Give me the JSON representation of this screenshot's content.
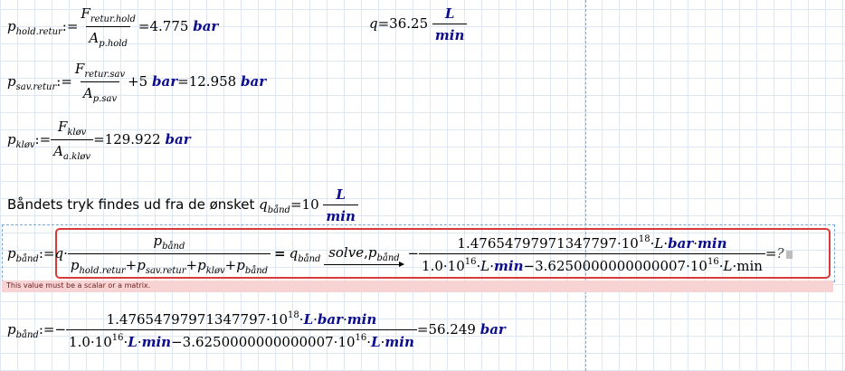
{
  "eq_hold": {
    "lhs": "p",
    "lhs_sub": "hold.retur",
    "assign": ":=",
    "num": "F",
    "num_sub": "retur.hold",
    "den": "A",
    "den_sub": "p.hold",
    "result": "=4.775",
    "unit": "bar"
  },
  "eq_q": {
    "lhs": "q",
    "result": "=36.25",
    "unit_num": "L",
    "unit_den": "min"
  },
  "eq_sav": {
    "lhs": "p",
    "lhs_sub": "sav.retur",
    "assign": ":=",
    "num": "F",
    "num_sub": "retur.sav",
    "den": "A",
    "den_sub": "p.sav",
    "plus": "+5",
    "unit1": "bar",
    "result": "=12.958",
    "unit2": "bar"
  },
  "eq_klov": {
    "lhs": "p",
    "lhs_sub": "kløv",
    "assign": ":=",
    "num": "F",
    "num_sub": "kløv",
    "den": "A",
    "den_sub": "a.kløv",
    "result": "=129.922",
    "unit": "bar"
  },
  "text_band": {
    "label": "Båndets tryk findes ud fra de ønsket",
    "var": "q",
    "var_sub": "bånd",
    "result": "=10",
    "unit_num": "L",
    "unit_den": "min"
  },
  "solve_eq": {
    "lhs": "p",
    "lhs_sub": "bånd",
    "assign": ":=",
    "q": "q",
    "dot": "·",
    "frac_num": "p",
    "frac_num_sub": "bånd",
    "den_t1": "p",
    "den_t1_sub": "hold.retur",
    "den_t2": "p",
    "den_t2_sub": "sav.retur",
    "den_t3": "p",
    "den_t3_sub": "kløv",
    "den_t4": "p",
    "den_t4_sub": "bånd",
    "plus": "+",
    "equals": "=",
    "rhs_q": "q",
    "rhs_q_sub": "bånd",
    "keyword": "solve",
    "keyword_sep": ",",
    "keyword_var": "p",
    "keyword_var_sub": "bånd",
    "minus": "−",
    "res_num_mant": "1.47654797971347797",
    "res_num_base": "10",
    "res_num_exp": "18",
    "res_num_L": "L",
    "res_num_bar": "bar",
    "res_num_min": "min",
    "res_den_a": "1.0",
    "res_den_base": "10",
    "res_den_exp": "16",
    "res_den_L": "L",
    "res_den_min": "min",
    "res_den_minus": "−3.6250000000000007",
    "res_den_base2": "10",
    "res_den_exp2": "16",
    "res_den_L2": "L",
    "res_den_min2": "min",
    "tail": "=",
    "qmark": "?"
  },
  "error_message": "This value must be a scalar or a matrix.",
  "final_eq": {
    "lhs": "p",
    "lhs_sub": "bånd",
    "assign": ":=",
    "minus": "−",
    "num_mant": "1.47654797971347797",
    "num_base": "10",
    "num_exp": "18",
    "num_L": "L",
    "num_bar": "bar",
    "num_min": "min",
    "den_a": "1.0",
    "den_base": "10",
    "den_exp": "16",
    "den_L": "L",
    "den_min": "min",
    "den_minus": "−3.6250000000000007",
    "den_base2": "10",
    "den_exp2": "16",
    "den_L2": "L",
    "den_min2": "min",
    "result": "=56.249",
    "unit": "bar"
  },
  "colors": {
    "unit": "#0b0b8c",
    "error_bg": "#f7d3d3",
    "error_border": "#d93b3b",
    "grid": "#dde8f4"
  }
}
